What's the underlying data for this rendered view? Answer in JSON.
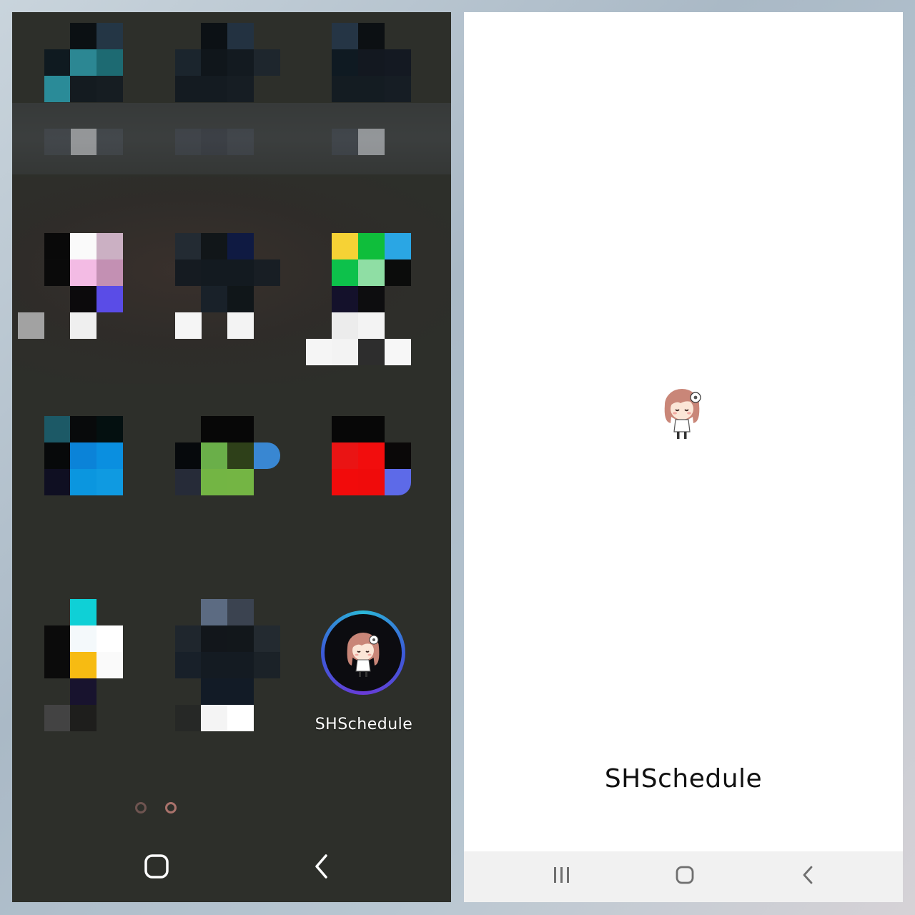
{
  "home_screen": {
    "shschedule_app": {
      "label": "SHSchedule",
      "icon": "girl-avatar-icon",
      "ring_colors": [
        "#2bb8d8",
        "#3b5bd8",
        "#6a3bd8"
      ]
    },
    "pixelated_apps_note_hidden": true,
    "page_indicator": {
      "pages": 2,
      "current": 2
    },
    "navbar": {
      "buttons": [
        "home-icon",
        "back-icon"
      ]
    },
    "background": "#2d2f2a"
  },
  "splash_screen": {
    "title": "SHSchedule",
    "figure": "girl-avatar-icon",
    "background": "#ffffff",
    "navbar": {
      "buttons": [
        "recents-icon",
        "home-icon",
        "back-icon"
      ],
      "background": "#f1f1f1"
    }
  }
}
